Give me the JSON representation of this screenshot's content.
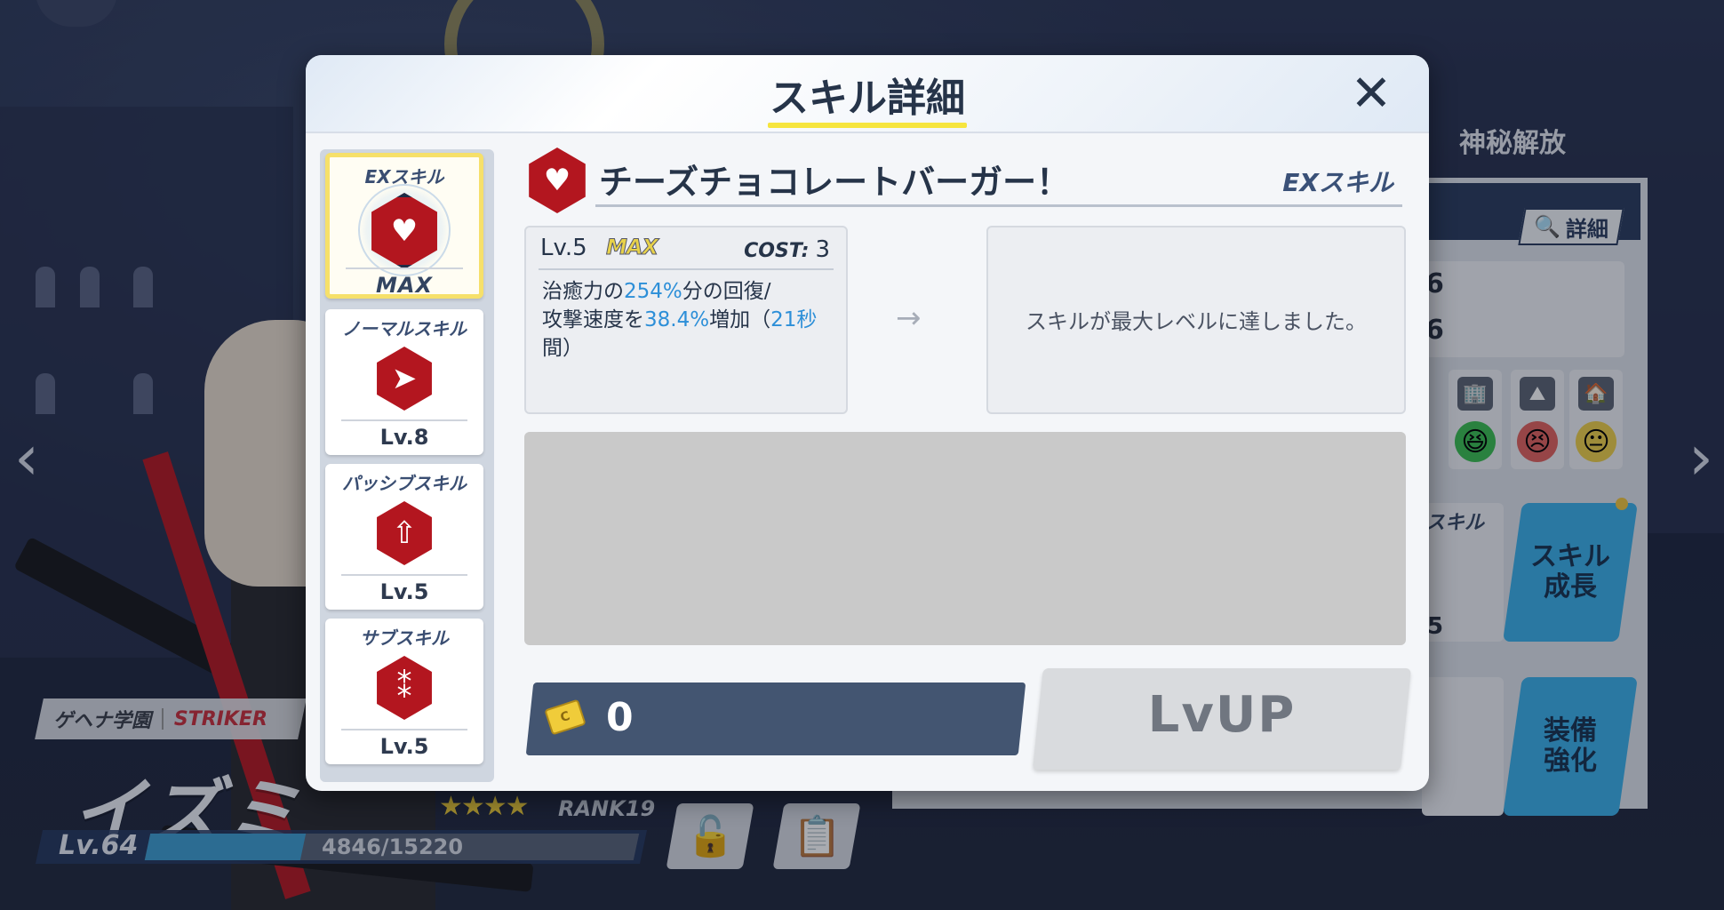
{
  "modal": {
    "title": "スキル詳細",
    "close_glyph": "✕"
  },
  "skill_list": [
    {
      "type_label": "EXスキル",
      "level": "MAX",
      "icon": "heart-plus-icon",
      "selected": true
    },
    {
      "type_label": "ノーマルスキル",
      "level": "Lv.8",
      "icon": "bullet-arrow-icon",
      "selected": false
    },
    {
      "type_label": "パッシブスキル",
      "level": "Lv.5",
      "icon": "person-up-icon",
      "selected": false
    },
    {
      "type_label": "サブスキル",
      "level": "Lv.5",
      "icon": "bullets-icon",
      "selected": false
    }
  ],
  "skill_detail": {
    "name": "チーズチョコレートバーガー！",
    "type": "EXスキル",
    "current": {
      "level": "Lv.5",
      "max_badge": "MAX",
      "cost_label": "COST",
      "cost_sep": ":",
      "cost_value": "3",
      "desc": {
        "l1a": "治癒力の",
        "l1b": "254%",
        "l1c": "分の回復/",
        "l2a": "攻撃速度を",
        "l2b": "38.4%",
        "l2c": "増加（",
        "l2d": "21秒",
        "l2e": "間）"
      }
    },
    "arrow": "→",
    "next_text": "スキルが最大レベルに達しました。"
  },
  "footer": {
    "credit_value": "0",
    "credit_icon_glyph": "C",
    "lvup_label": "LvUP"
  },
  "background": {
    "right_title": "神秘解放",
    "detail_button": "詳細",
    "detail_icon_glyph": "🔍",
    "stat_values": [
      "6",
      "6"
    ],
    "skill_card_label": "スキル",
    "skill_card_value": "5",
    "skill_growth_button": "スキル\n成長",
    "equip_button": "装備\n強化",
    "terrain_icons": [
      "🏢",
      "⛰",
      "🏠"
    ],
    "terrain_faces": [
      "😆",
      "😣",
      "😐"
    ],
    "school": "ゲヘナ学園",
    "role": "STRIKER",
    "character_name": "イズミ",
    "level": "Lv.64",
    "exp_text": "4846/15220",
    "exp_progress": 0.318,
    "stars": "★★★★",
    "rank": "RANK19",
    "nav_left": "‹",
    "nav_right": "›",
    "bottom_buttons": [
      "🔓",
      "📋"
    ]
  },
  "colors": {
    "accent_yellow": "#f6e53e",
    "skill_red": "#b3161f",
    "highlight_blue": "#2d8fd8",
    "navy": "#263449",
    "skill_blue_button": "#3cb1ea"
  }
}
